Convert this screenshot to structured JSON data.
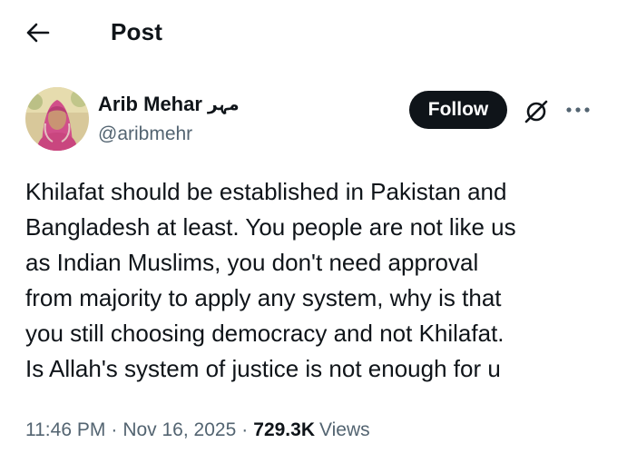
{
  "header": {
    "title": "Post",
    "back_icon": "arrow-left-icon"
  },
  "author": {
    "display_name": "Arib Mehar",
    "native_name": "مہر",
    "handle": "@aribmehr",
    "follow_label": "Follow",
    "grok_icon": "grok-icon",
    "more_icon": "more-horizontal-icon"
  },
  "post": {
    "lines": [
      "Khilafat should be established in Pakistan and",
      "Bangladesh at least. You people are not like us",
      "as Indian Muslims, you don't need approval",
      "from majority to apply any system, why is that",
      "you still choosing democracy and not Khilafat.",
      "Is Allah's system of justice is not enough for u"
    ]
  },
  "meta": {
    "time": "11:46 PM",
    "separator": "·",
    "date": "Nov 16, 2025",
    "views_count": "729.3K",
    "views_label": "Views"
  },
  "colors": {
    "text_primary": "#0f1419",
    "text_secondary": "#536471",
    "follow_bg": "#0f1419",
    "follow_text": "#ffffff",
    "background": "#ffffff"
  }
}
